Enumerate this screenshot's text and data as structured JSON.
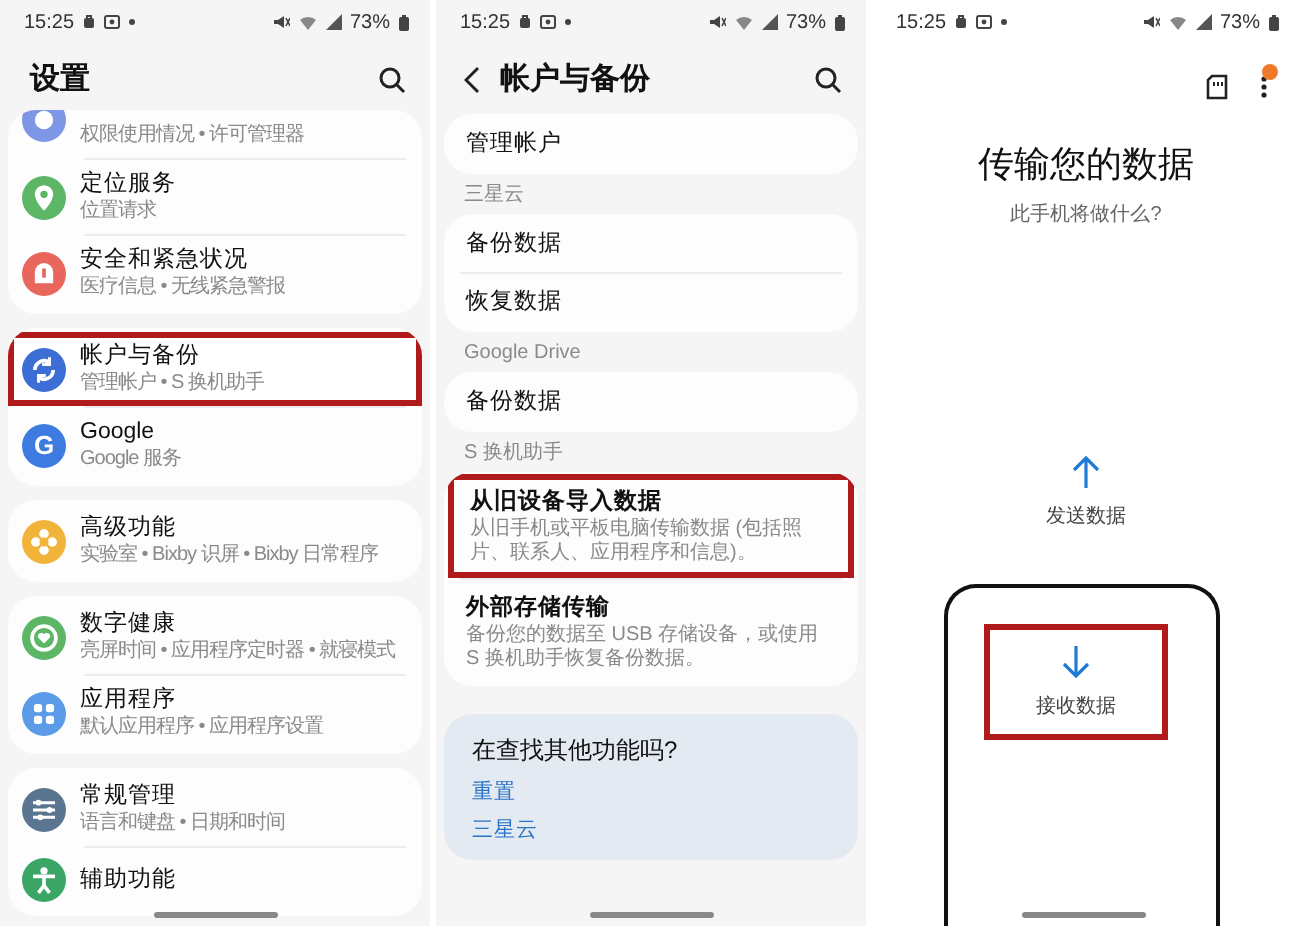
{
  "settings": {
    "status_bar": {
      "time": "15:25",
      "battery": "73%"
    },
    "title": "设置",
    "groups": [
      {
        "items": [
          {
            "kind": "partial",
            "color": "#7d97e6",
            "subtitle": "权限使用情况 • 许可管理器",
            "highlighted": false
          },
          {
            "kind": "full",
            "color": "#5db665",
            "title": "定位服务",
            "subtitle": "位置请求",
            "highlighted": false
          },
          {
            "kind": "full",
            "color": "#e8665c",
            "title": "安全和紧急状况",
            "subtitle": "医疗信息 • 无线紧急警报",
            "highlighted": false
          }
        ]
      },
      {
        "items": [
          {
            "kind": "full",
            "color": "#3d6ed6",
            "title": "帐户与备份",
            "subtitle": "管理帐户 • S 换机助手",
            "highlighted": true
          },
          {
            "kind": "full",
            "glyph": "G",
            "color": "#3e7be0",
            "title": "Google",
            "subtitle": "Google 服务",
            "highlighted": false
          }
        ]
      },
      {
        "items": [
          {
            "kind": "full",
            "color": "#f2b33a",
            "title": "高级功能",
            "subtitle": "实验室 • Bixby 识屏 • Bixby 日常程序",
            "highlighted": false
          }
        ]
      },
      {
        "items": [
          {
            "kind": "full",
            "color": "#5db665",
            "title": "数字健康",
            "subtitle": "亮屏时间 • 应用程序定时器 • 就寝模式",
            "highlighted": false
          },
          {
            "kind": "full",
            "color": "#5b9be8",
            "title": "应用程序",
            "subtitle": "默认应用程序 • 应用程序设置",
            "highlighted": false
          }
        ]
      },
      {
        "items": [
          {
            "kind": "full",
            "color": "#5a7590",
            "title": "常规管理",
            "subtitle": "语言和键盘 • 日期和时间",
            "highlighted": false
          },
          {
            "kind": "title_only",
            "color": "#3aa565",
            "title": "辅助功能",
            "highlighted": false
          }
        ]
      }
    ]
  },
  "accounts": {
    "status_bar": {
      "time": "15:25",
      "battery": "73%"
    },
    "title": "帐户与备份",
    "sections": [
      {
        "items": [
          {
            "title": "管理帐户",
            "highlighted": false
          }
        ]
      },
      {
        "header": "三星云",
        "items": [
          {
            "title": "备份数据",
            "highlighted": false
          },
          {
            "title": "恢复数据",
            "highlighted": false
          }
        ]
      },
      {
        "header": "Google Drive",
        "items": [
          {
            "title": "备份数据",
            "highlighted": false
          }
        ]
      },
      {
        "header": "S 换机助手",
        "items": [
          {
            "title": "从旧设备导入数据",
            "description": "从旧手机或平板电脑传输数据 (包括照片、联系人、应用程序和信息)。",
            "highlighted": true
          },
          {
            "title": "外部存储传输",
            "description": "备份您的数据至 USB 存储设备，或使用 S 换机助手恢复备份数据。",
            "highlighted": false
          }
        ]
      }
    ],
    "suggestions": {
      "title": "在查找其他功能吗?",
      "links": [
        "重置",
        "三星云"
      ]
    }
  },
  "transfer": {
    "status_bar": {
      "time": "15:25",
      "battery": "73%"
    },
    "menu_badge": true,
    "title": "传输您的数据",
    "subtitle": "此手机将做什么?",
    "options": [
      {
        "kind": "send",
        "label": "发送数据",
        "highlighted": false
      },
      {
        "kind": "receive",
        "label": "接收数据",
        "highlighted": true
      }
    ]
  }
}
